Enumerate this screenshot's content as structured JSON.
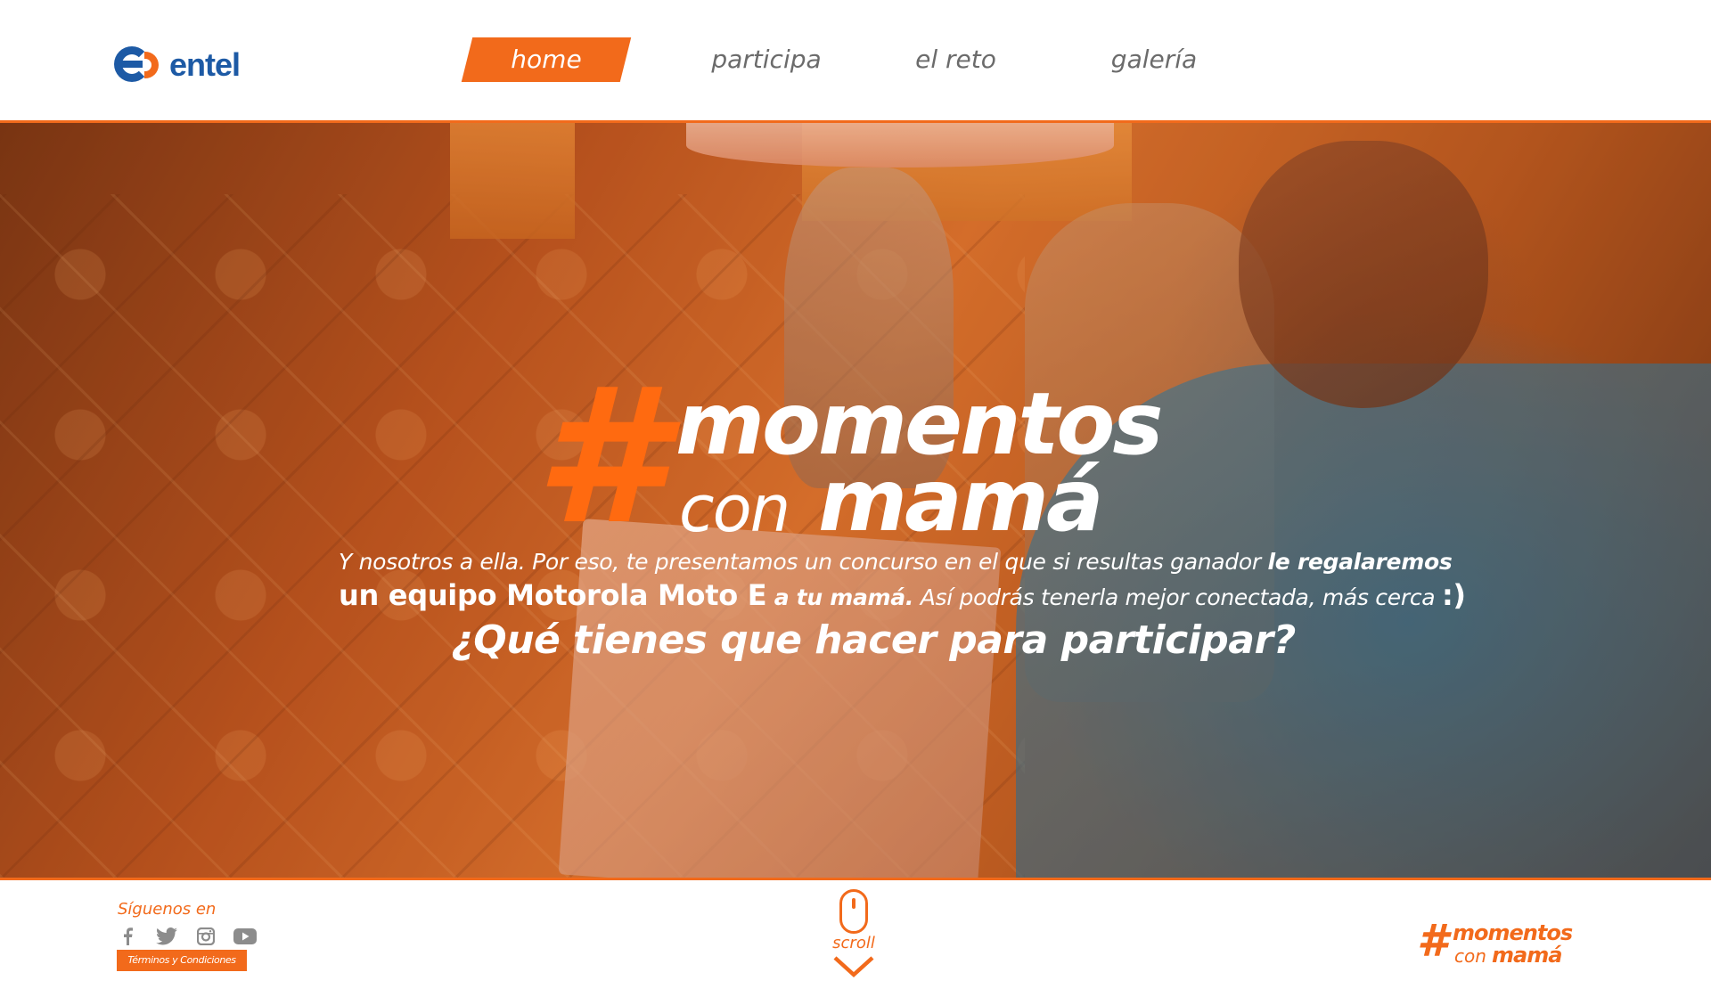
{
  "brand": {
    "name": "entel",
    "colors": {
      "orange": "#f26a1b",
      "blue": "#1d5aa5"
    }
  },
  "nav": {
    "items": [
      {
        "label": "home",
        "active": true
      },
      {
        "label": "participa",
        "active": false
      },
      {
        "label": "el reto",
        "active": false
      },
      {
        "label": "galería",
        "active": false
      }
    ]
  },
  "hero": {
    "hashtag": "#",
    "title_line1": "momentos",
    "title_con": "con",
    "title_mama": "mamá",
    "intro": {
      "l1_regular": "Y nosotros a ella. Por eso, te presentamos un concurso en el que si resultas ganador ",
      "l1_bold": "le regalaremos",
      "l2_bold": "un equipo Motorola Moto E",
      "l2_bold_small": " a tu mamá.",
      "l2_regular": " Así podrás tenerla mejor conectada, más cerca ",
      "l2_smiley": ":)"
    },
    "question": "¿Qué tienes que hacer para participar?",
    "background_image": "photo-of-mother-looking-at-photo-album"
  },
  "footer": {
    "follow_label": "Síguenos en",
    "socials": [
      "facebook-icon",
      "twitter-icon",
      "instagram-icon",
      "youtube-icon"
    ],
    "terms_label": "Términos y Condiciones",
    "scroll_label": "scroll",
    "logo": {
      "hash": "#",
      "line1": "momentos",
      "con": "con",
      "mama": "mamá"
    }
  }
}
